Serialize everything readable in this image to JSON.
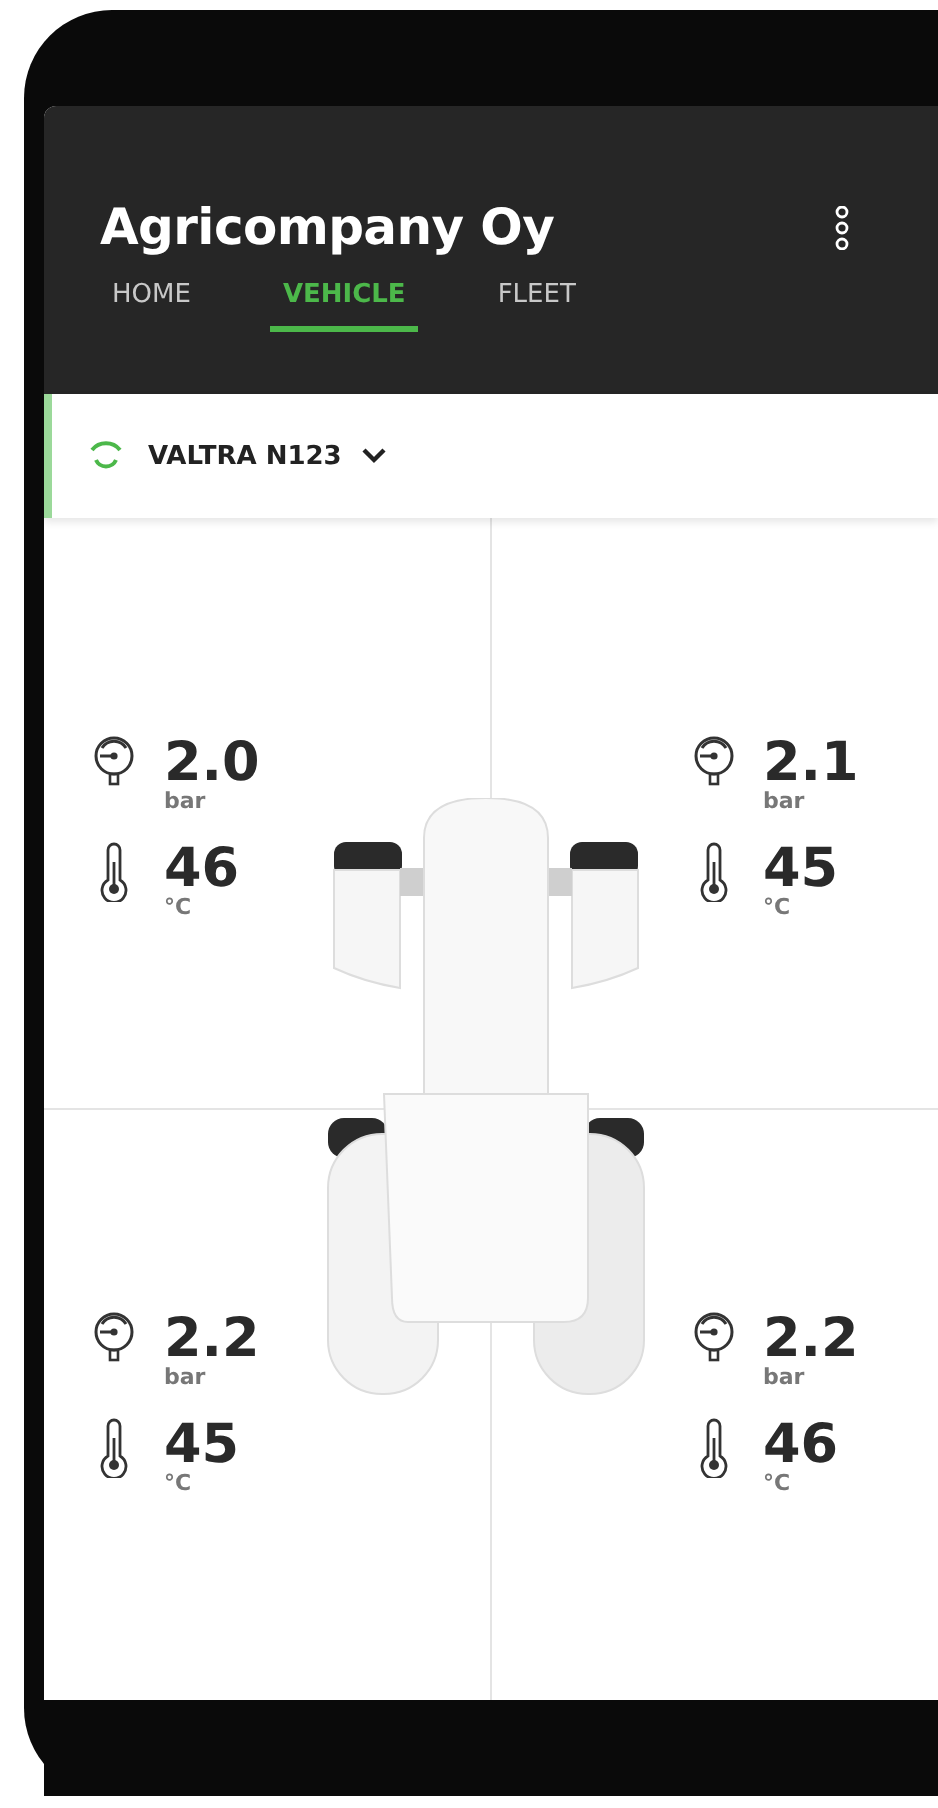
{
  "header": {
    "title": "Agricompany Oy"
  },
  "tabs": [
    {
      "label": "HOME",
      "selected": false
    },
    {
      "label": "VEHICLE",
      "selected": true
    },
    {
      "label": "FLEET",
      "selected": false
    }
  ],
  "vehicle": {
    "name": "VALTRA N123",
    "connected": true
  },
  "tires": [
    {
      "pressure": "2.0",
      "pressure_unit": "bar",
      "temperature": "46",
      "temperature_unit": "°C"
    },
    {
      "pressure": "2.1",
      "pressure_unit": "bar",
      "temperature": "45",
      "temperature_unit": "°C"
    },
    {
      "pressure": "2.2",
      "pressure_unit": "bar",
      "temperature": "45",
      "temperature_unit": "°C"
    },
    {
      "pressure": "2.2",
      "pressure_unit": "bar",
      "temperature": "46",
      "temperature_unit": "°C"
    }
  ]
}
